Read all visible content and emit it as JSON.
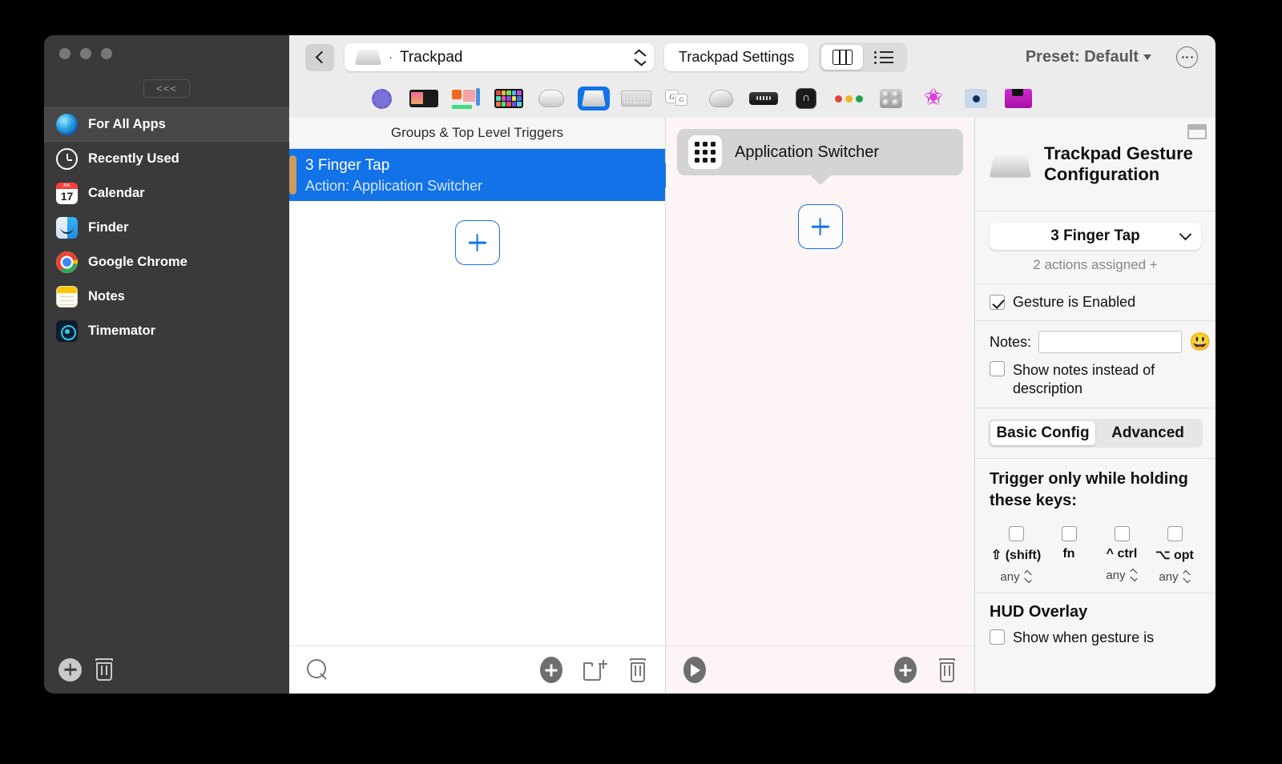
{
  "window": {
    "traffic_lights": [
      "close",
      "minimize",
      "zoom"
    ],
    "collapse_label": "<<<"
  },
  "sidebar": {
    "items": [
      {
        "label": "For All Apps",
        "icon": "globe-icon",
        "selected": true
      },
      {
        "label": "Recently Used",
        "icon": "clock-icon",
        "selected": false
      },
      {
        "label": "Calendar",
        "icon": "calendar-icon",
        "selected": false
      },
      {
        "label": "Finder",
        "icon": "finder-icon",
        "selected": false
      },
      {
        "label": "Google Chrome",
        "icon": "chrome-icon",
        "selected": false
      },
      {
        "label": "Notes",
        "icon": "notes-icon",
        "selected": false
      },
      {
        "label": "Timemator",
        "icon": "timemator-icon",
        "selected": false
      }
    ],
    "calendar_icon": {
      "month": "JUL",
      "day": "17"
    },
    "footer": {
      "add": "add-app-button",
      "delete": "delete-app-button"
    }
  },
  "toolbar": {
    "back": "back-button",
    "device_select": {
      "value": "Trackpad",
      "separator": "·",
      "icon": "trackpad-icon"
    },
    "settings_button": "Trackpad Settings",
    "view_modes": [
      {
        "name": "column-view",
        "icon": "columns-icon",
        "active": true
      },
      {
        "name": "list-view",
        "icon": "list-icon",
        "active": false
      }
    ],
    "preset_label": "Preset: Default",
    "more_button": "more-options-button"
  },
  "device_strip": {
    "devices": [
      {
        "name": "generic-device",
        "active": false
      },
      {
        "name": "touch-bar",
        "active": false
      },
      {
        "name": "stream-deck",
        "active": false
      },
      {
        "name": "midi-grid",
        "active": false
      },
      {
        "name": "magic-mouse",
        "active": false
      },
      {
        "name": "trackpad",
        "active": true
      },
      {
        "name": "keyboard",
        "active": false
      },
      {
        "name": "key-sequences",
        "active": false
      },
      {
        "name": "normal-mouse",
        "active": false
      },
      {
        "name": "remote-control",
        "active": false
      },
      {
        "name": "drawing-pad",
        "active": false
      },
      {
        "name": "window-snapping",
        "active": false
      },
      {
        "name": "midi-knobs",
        "active": false
      },
      {
        "name": "shortcuts",
        "active": false
      },
      {
        "name": "controller",
        "active": false
      },
      {
        "name": "floppy-device",
        "active": false
      }
    ]
  },
  "triggers_pane": {
    "header": "Groups & Top Level Triggers",
    "rows": [
      {
        "title": "3 Finger Tap",
        "subtitle": "Action: Application Switcher",
        "selected": true
      }
    ],
    "add_button": "add-trigger-button",
    "footer": {
      "search": "search-triggers-button",
      "add": "add-trigger-footer-button",
      "new_group": "new-group-button",
      "delete": "delete-trigger-button"
    }
  },
  "actions_pane": {
    "actions": [
      {
        "label": "Application Switcher",
        "icon": "app-switcher-grid-icon"
      }
    ],
    "add_button": "add-action-button",
    "footer": {
      "run": "run-action-button",
      "add": "add-action-footer-button",
      "delete": "delete-action-button"
    }
  },
  "config_pane": {
    "title": "Trackpad Gesture Configuration",
    "panel_toggle": "toggle-panel-button",
    "gesture_select": "3 Finger Tap",
    "assigned_text": "2 actions assigned +",
    "gesture_enabled": {
      "label": "Gesture is Enabled",
      "checked": true
    },
    "notes": {
      "label": "Notes:",
      "value": "",
      "placeholder": "",
      "emoji": "😃"
    },
    "show_notes": {
      "label": "Show notes instead of description",
      "checked": false
    },
    "tabs": [
      {
        "label": "Basic Config",
        "active": true
      },
      {
        "label": "Advanced",
        "active": false
      }
    ],
    "modifiers_title": "Trigger only while holding these keys:",
    "modifiers": [
      {
        "label": "⇧ (shift)",
        "checked": false,
        "mode": "any"
      },
      {
        "label": "fn",
        "checked": false,
        "mode": ""
      },
      {
        "label": "^ ctrl",
        "checked": false,
        "mode": "any"
      },
      {
        "label": "⌥ opt",
        "checked": false,
        "mode": "any"
      }
    ],
    "hud_title": "HUD Overlay",
    "hud_option": {
      "label": "Show when gesture is",
      "checked": false
    }
  },
  "colors": {
    "accent": "#1272e8",
    "sidebar_bg": "#3a3a3a",
    "toolbar_bg": "#ececec",
    "actions_bg": "#fdf5f5",
    "config_bg": "#f6f6f6",
    "trigger_edge": "#d09a5e"
  }
}
